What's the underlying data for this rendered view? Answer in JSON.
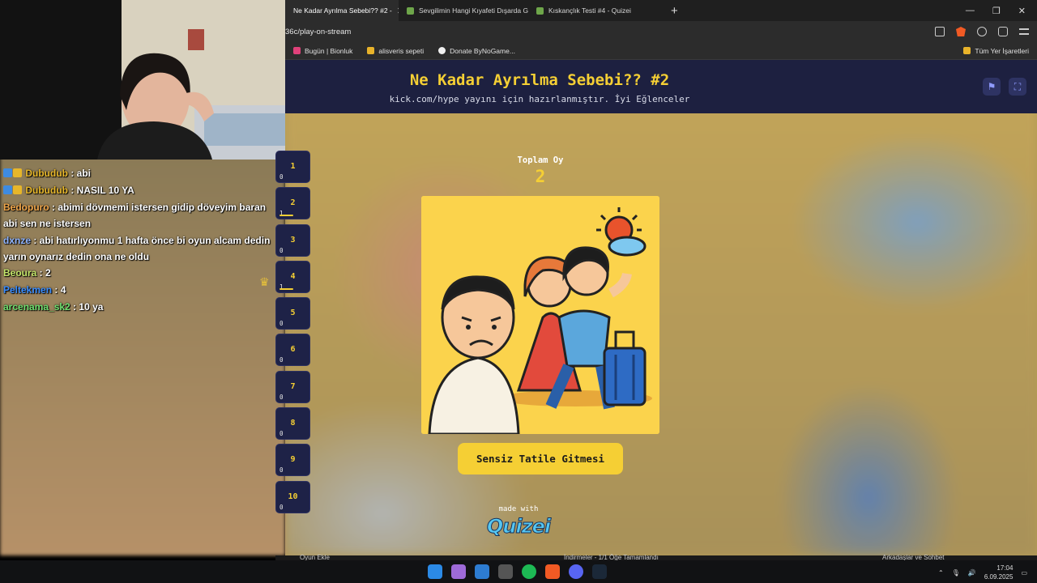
{
  "browser": {
    "tabs": [
      {
        "label": "Ne Kadar Ayrılma Sebebi?? #2 -",
        "active": true
      },
      {
        "label": "Sevgilimin Hangi Kıyafeti Dışarda Giye",
        "active": false
      },
      {
        "label": "Kıskançlık Testi #4 - Quizei",
        "active": false
      }
    ],
    "url": "36c/play-on-stream",
    "bookmarks": [
      {
        "label": "Bugün | Bionluk"
      },
      {
        "label": "alisveris sepeti"
      },
      {
        "label": "Donate ByNoGame..."
      }
    ],
    "bookmarks_right": "Tüm Yer İşaretleri"
  },
  "quiz": {
    "title": "Ne Kadar Ayrılma Sebebi?? #2",
    "subtitle": "kick.com/hype yayını için hazırlanmıştır. İyi Eğlenceler",
    "total_label": "Toplam Oy",
    "total_value": "2",
    "answer": "Sensiz Tatile Gitmesi",
    "made_with": "made with",
    "logo": "Quizei",
    "questions": [
      {
        "num": "1",
        "votes": "0",
        "fill": 0
      },
      {
        "num": "2",
        "votes": "1",
        "fill": 0.5
      },
      {
        "num": "3",
        "votes": "0",
        "fill": 0
      },
      {
        "num": "4",
        "votes": "1",
        "fill": 0.5
      },
      {
        "num": "5",
        "votes": "0",
        "fill": 0
      },
      {
        "num": "6",
        "votes": "0",
        "fill": 0
      },
      {
        "num": "7",
        "votes": "0",
        "fill": 0
      },
      {
        "num": "8",
        "votes": "0",
        "fill": 0
      },
      {
        "num": "9",
        "votes": "0",
        "fill": 0
      },
      {
        "num": "10",
        "votes": "0",
        "fill": 0
      }
    ]
  },
  "chat": {
    "messages": [
      {
        "user": "Dubudub",
        "text": " : abi",
        "color": "#e7b62a",
        "badges": true
      },
      {
        "user": "Dubudub",
        "text": " : NASIL 10 YA",
        "color": "#e7b62a",
        "badges": true
      },
      {
        "user": "Bedopuro",
        "text": " : abimi dövmemi istersen gidip döveyim baran abi sen ne istersen",
        "color": "#f0a64a",
        "badges": false
      },
      {
        "user": "dxnze",
        "text": " : abi hatırlıyonmu 1 hafta önce bi oyun alcam dedin yarın oynarız dedin ona ne oldu",
        "color": "#8fb4ff",
        "badges": false
      },
      {
        "user": "Beoura",
        "text": " : 2",
        "color": "#c4e56a",
        "badges": false
      },
      {
        "user": "Peltekmen",
        "text": " : 4",
        "color": "#3a8dff",
        "badges": false
      },
      {
        "user": "arcenama_sk2",
        "text": " : 10 ya",
        "color": "#6fe06f",
        "badges": false
      }
    ]
  },
  "app_strip": {
    "left": "Oyun Ekle",
    "center": "İndirmeler - 1/1 Öğe Tamamlandı",
    "right": "Arkadaşlar ve Sohbet"
  },
  "taskbar": {
    "time": "17:04",
    "date": "6.09.2025"
  }
}
